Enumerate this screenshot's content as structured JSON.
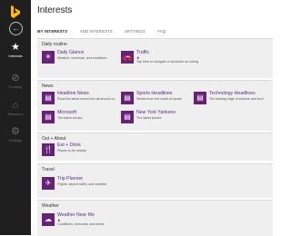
{
  "sidebar": {
    "nav": [
      {
        "icon": "★",
        "label": "Interests"
      },
      {
        "icon": "⊘",
        "label": "Cooking"
      },
      {
        "icon": "⌂",
        "label": "Research"
      },
      {
        "icon": "⚙",
        "label": "Settings"
      }
    ]
  },
  "header": {
    "title": "Interests"
  },
  "tabs": [
    {
      "label": "MY INTERESTS"
    },
    {
      "label": "ADD INTERESTS"
    },
    {
      "label": "SETTINGS"
    },
    {
      "label": "FAQ"
    }
  ],
  "sections": [
    {
      "title": "Daily routine",
      "tiles": [
        {
          "name": "Daily Glance",
          "desc": "Weather, commute, and headlines",
          "icon": "☀"
        },
        {
          "name": "Traffic",
          "star": "★",
          "desc": "Tap here to navigate or schedule an outing",
          "icon": "🚗"
        }
      ]
    },
    {
      "title": "News",
      "tiles": [
        {
          "name": "Headline News",
          "desc": "Read the latest news from all around us",
          "icon": "▤"
        },
        {
          "name": "Sports Headlines",
          "desc": "Stories from the world of sports",
          "icon": "▤"
        },
        {
          "name": "Technology Headlines",
          "desc": "The leading edge of science and tech",
          "icon": "▤"
        },
        {
          "name": "Microsoft",
          "desc": "The latest stories",
          "icon": "▤"
        },
        {
          "name": "New York Yankees",
          "desc": "The latest stories",
          "icon": "▤"
        }
      ]
    },
    {
      "title": "Out + About",
      "tiles": [
        {
          "name": "Eat + Drink",
          "desc": "Places to try nearby",
          "icon": "🍴"
        }
      ]
    },
    {
      "title": "Travel",
      "tiles": [
        {
          "name": "Trip Planner",
          "desc": "Flights, airport traffic, and weather",
          "icon": "✈"
        }
      ]
    },
    {
      "title": "Weather",
      "tiles": [
        {
          "name": "Weather Near Me",
          "star": "★",
          "desc": "Conditions, forecasts, and alerts",
          "icon": "☁"
        }
      ]
    }
  ],
  "colors": {
    "sidebar": "#1f1f1f",
    "tile": "#68217a",
    "section_bg": "#efefef"
  }
}
